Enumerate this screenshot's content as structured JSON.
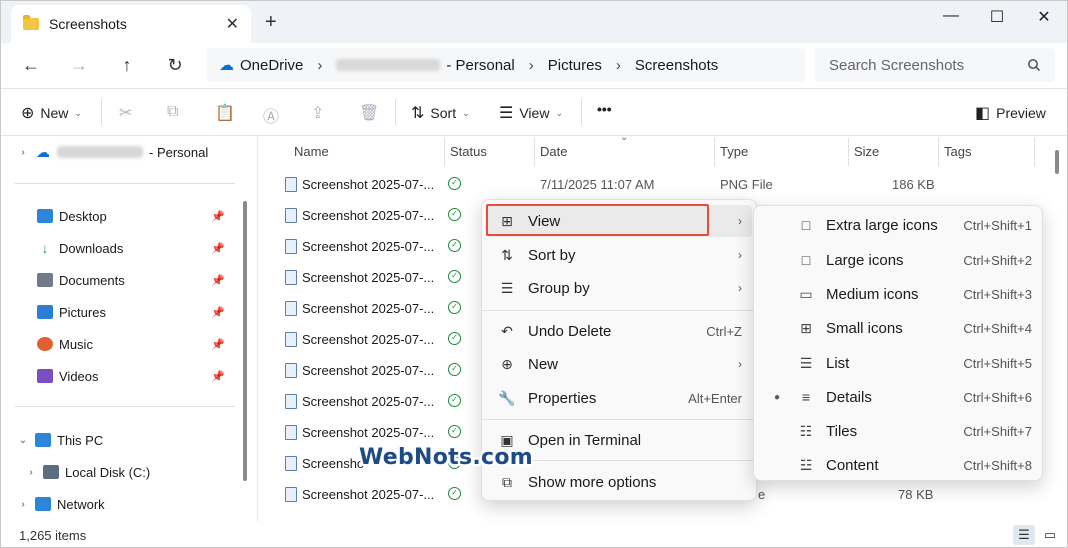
{
  "window": {
    "tab_title": "Screenshots",
    "tab_close": "✕",
    "new_tab": "+",
    "minimize": "—",
    "maximize": "☐",
    "close": "✕"
  },
  "nav": {
    "back": "←",
    "forward": "→",
    "up": "↑",
    "refresh": "↻"
  },
  "breadcrumb": {
    "root": "OneDrive",
    "account_suffix": "- Personal",
    "folder1": "Pictures",
    "folder2": "Screenshots",
    "separator": "›"
  },
  "search": {
    "placeholder": "Search Screenshots",
    "icon": "search-icon"
  },
  "toolbar": {
    "new_label": "New",
    "sort_label": "Sort",
    "view_label": "View",
    "more_label": "•••",
    "preview_label": "Preview"
  },
  "sidebar": {
    "onedrive_suffix": "- Personal",
    "quick_access": [
      {
        "label": "Desktop",
        "icon": "desktop-icon",
        "color": "#2b86d8"
      },
      {
        "label": "Downloads",
        "icon": "downloads-icon",
        "color": "#2e9e5b"
      },
      {
        "label": "Documents",
        "icon": "documents-icon",
        "color": "#6f7b89"
      },
      {
        "label": "Pictures",
        "icon": "pictures-icon",
        "color": "#2a7fd4"
      },
      {
        "label": "Music",
        "icon": "music-icon",
        "color": "#e0612f"
      },
      {
        "label": "Videos",
        "icon": "videos-icon",
        "color": "#7a4ec2"
      }
    ],
    "this_pc": "This PC",
    "local_disk": "Local Disk (C:)",
    "network": "Network"
  },
  "columns": {
    "name": "Name",
    "status": "Status",
    "date": "Date",
    "type": "Type",
    "size": "Size",
    "tags": "Tags"
  },
  "files": {
    "first_row": {
      "name": "Screenshot 2025-07-...",
      "date": "7/11/2025 11:07 AM",
      "type": "PNG File",
      "size": "186 KB"
    },
    "names": [
      "Screenshot 2025-07-...",
      "Screenshot 2025-07-...",
      "Screenshot 2025-07-...",
      "Screenshot 2025-07-...",
      "Screenshot 2025-07-...",
      "Screenshot 2025-07-...",
      "Screenshot 2025-07-...",
      "Screenshot 2025-07-...",
      "Screensho",
      "Screenshot 2025-07-..."
    ],
    "partial_type": "e",
    "last_size": "78 KB"
  },
  "status": {
    "item_count": "1,265 items"
  },
  "context_menu": {
    "view": "View",
    "sort_by": "Sort by",
    "group_by": "Group by",
    "undo_delete": "Undo Delete",
    "undo_shortcut": "Ctrl+Z",
    "new": "New",
    "properties": "Properties",
    "properties_shortcut": "Alt+Enter",
    "open_terminal": "Open in Terminal",
    "show_more": "Show more options"
  },
  "view_submenu": [
    {
      "label": "Extra large icons",
      "shortcut": "Ctrl+Shift+1",
      "icon": "□"
    },
    {
      "label": "Large icons",
      "shortcut": "Ctrl+Shift+2",
      "icon": "□"
    },
    {
      "label": "Medium icons",
      "shortcut": "Ctrl+Shift+3",
      "icon": "▭"
    },
    {
      "label": "Small icons",
      "shortcut": "Ctrl+Shift+4",
      "icon": "⊞"
    },
    {
      "label": "List",
      "shortcut": "Ctrl+Shift+5",
      "icon": "☰"
    },
    {
      "label": "Details",
      "shortcut": "Ctrl+Shift+6",
      "icon": "≡"
    },
    {
      "label": "Tiles",
      "shortcut": "Ctrl+Shift+7",
      "icon": "☷"
    },
    {
      "label": "Content",
      "shortcut": "Ctrl+Shift+8",
      "icon": "☳"
    }
  ],
  "watermark": "WebNots.com",
  "colors": {
    "highlight_border": "#e64b3c",
    "accent": "#0a6fd1",
    "status_ok": "#1c8a3b"
  }
}
